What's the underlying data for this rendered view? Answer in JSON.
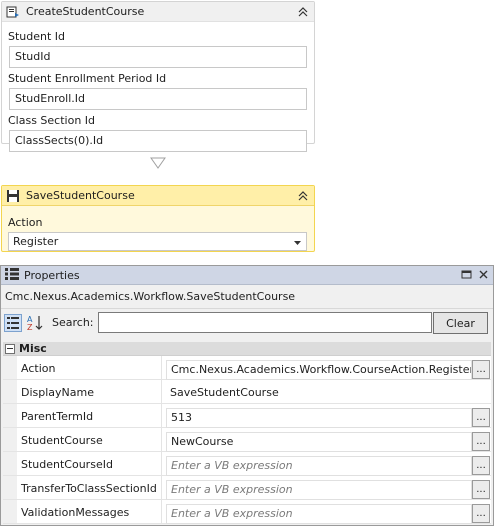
{
  "create_card": {
    "title": "CreateStudentCourse",
    "fields": [
      {
        "label": "Student Id",
        "value": "StudId"
      },
      {
        "label": "Student Enrollment Period Id",
        "value": "StudEnroll.Id"
      },
      {
        "label": "Class Section Id",
        "value": "ClassSects(0).Id"
      }
    ]
  },
  "save_card": {
    "title": "SaveStudentCourse",
    "action_label": "Action",
    "action_value": "Register"
  },
  "properties": {
    "title": "Properties",
    "type_name": "Cmc.Nexus.Academics.Workflow.SaveStudentCourse",
    "search_label": "Search:",
    "search_value": "",
    "clear_label": "Clear",
    "category": "Misc",
    "rows": [
      {
        "name": "Action",
        "value": "Cmc.Nexus.Academics.Workflow.CourseAction.Register"
      },
      {
        "name": "DisplayName",
        "value": "SaveStudentCourse"
      },
      {
        "name": "ParentTermId",
        "value": "513"
      },
      {
        "name": "StudentCourse",
        "value": "NewCourse"
      },
      {
        "name": "StudentCourseId",
        "placeholder": "Enter a VB expression"
      },
      {
        "name": "TransferToClassSectionId",
        "placeholder": "Enter a VB expression"
      },
      {
        "name": "ValidationMessages",
        "placeholder": "Enter a VB expression"
      }
    ],
    "ellipsis": "..."
  },
  "colors": {
    "selected_card_header": "#ffefa8",
    "selected_card_border": "#f3d54f",
    "panel_titlebar": "#cfd6e5",
    "placeholder_text": "#7a7a7a"
  }
}
